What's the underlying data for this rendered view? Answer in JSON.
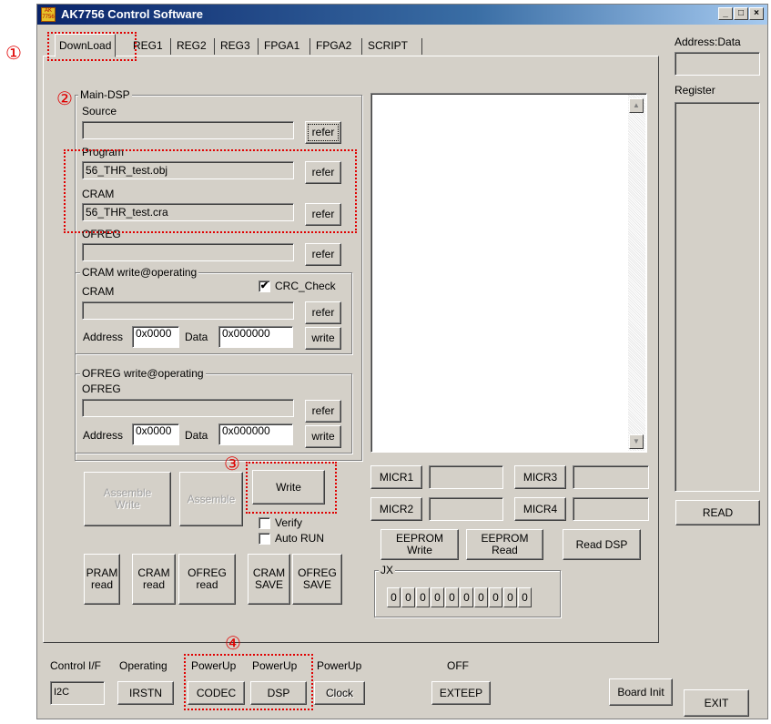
{
  "window": {
    "title": "AK7756 Control Software",
    "app_icon": "AK 7756",
    "btn_min": "_",
    "btn_max": "□",
    "btn_close": "×"
  },
  "tabs": [
    "DownLoad",
    "REG1",
    "REG2",
    "REG3",
    "FPGA1",
    "FPGA2",
    "SCRIPT"
  ],
  "markers": [
    "①",
    "②",
    "③",
    "④"
  ],
  "main_dsp": {
    "group_label": "Main-DSP",
    "source_label": "Source",
    "source_value": "",
    "program_label": "Program",
    "program_value": "56_THR_test.obj",
    "cram_label": "CRAM",
    "cram_value": "56_THR_test.cra",
    "ofreg_label": "OFREG",
    "ofreg_value": "",
    "refer_label": "refer"
  },
  "cram_write": {
    "group_label": "CRAM write@operating",
    "file_label": "CRAM",
    "file_value": "",
    "crc_label": "CRC_Check",
    "crc_checked": true,
    "address_label": "Address",
    "address_value": "0x0000",
    "data_label": "Data",
    "data_value": "0x000000",
    "refer_label": "refer",
    "write_label": "write"
  },
  "ofreg_write": {
    "group_label": "OFREG write@operating",
    "file_label": "OFREG",
    "file_value": "",
    "address_label": "Address",
    "address_value": "0x0000",
    "data_label": "Data",
    "data_value": "0x000000",
    "refer_label": "refer",
    "write_label": "write"
  },
  "actions": {
    "assemble_write": "Assemble\nWrite",
    "assemble": "Assemble",
    "write": "Write",
    "verify": "Verify",
    "auto_run": "Auto RUN",
    "pram_read": "PRAM\nread",
    "cram_read": "CRAM\nread",
    "ofreg_read": "OFREG\nread",
    "cram_save": "CRAM\nSAVE",
    "ofreg_save": "OFREG\nSAVE"
  },
  "micr": {
    "micr1": "MICR1",
    "micr2": "MICR2",
    "micr3": "MICR3",
    "micr4": "MICR4"
  },
  "eeprom": {
    "write": "EEPROM\nWrite",
    "read": "EEPROM\nRead",
    "read_dsp": "Read DSP"
  },
  "jx": {
    "label": "JX",
    "values": [
      "0",
      "0",
      "0",
      "0",
      "0",
      "0",
      "0",
      "0",
      "0",
      "0"
    ]
  },
  "right_panel": {
    "address_data_label": "Address:Data",
    "address_data_value": "",
    "register_label": "Register",
    "read_button": "READ"
  },
  "bottom": {
    "control_if_label": "Control I/F",
    "control_if_value": "I2C",
    "operating_label": "Operating",
    "operating_button": "IRSTN",
    "powerup_codec_label": "PowerUp",
    "codec_button": "CODEC",
    "powerup_dsp_label": "PowerUp",
    "dsp_button": "DSP",
    "powerup_clock_label": "PowerUp",
    "clock_button": "Clock",
    "exteep_label": "OFF",
    "exteep_button": "EXTEEP",
    "board_init": "Board Init",
    "exit": "EXIT"
  },
  "colors": {
    "title_start": "#0a246a",
    "title_end": "#a6caf0",
    "face": "#d4d0c8",
    "highlight_red": "#e00000"
  }
}
